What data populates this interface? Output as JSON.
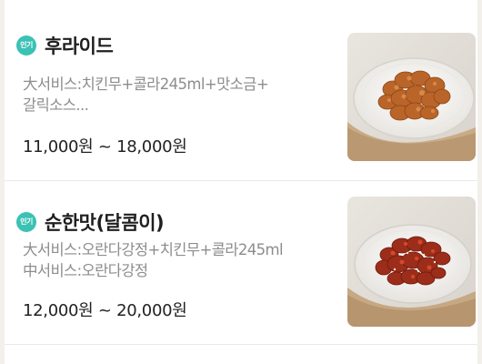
{
  "items": [
    {
      "badge": "인기",
      "name": "후라이드",
      "desc_line1": "大서비스:치킨무+콜라245ml+맛소금+",
      "desc_line2": "갈릭소스...",
      "price": "11,000원 ~ 18,000원",
      "image_icon": "fried-chicken-image",
      "chicken_color": "#b9652a"
    },
    {
      "badge": "인기",
      "name": "순한맛(달콤이)",
      "desc_line1": "大서비스:오란다강정+치킨무+콜라245ml",
      "desc_line2": "中서비스:오란다강정",
      "price": "12,000원 ~ 20,000원",
      "image_icon": "sweet-chicken-image",
      "chicken_color": "#9c2d1a"
    }
  ],
  "colors": {
    "badge": "#3cc1b5",
    "background": "#f3f0ec"
  }
}
